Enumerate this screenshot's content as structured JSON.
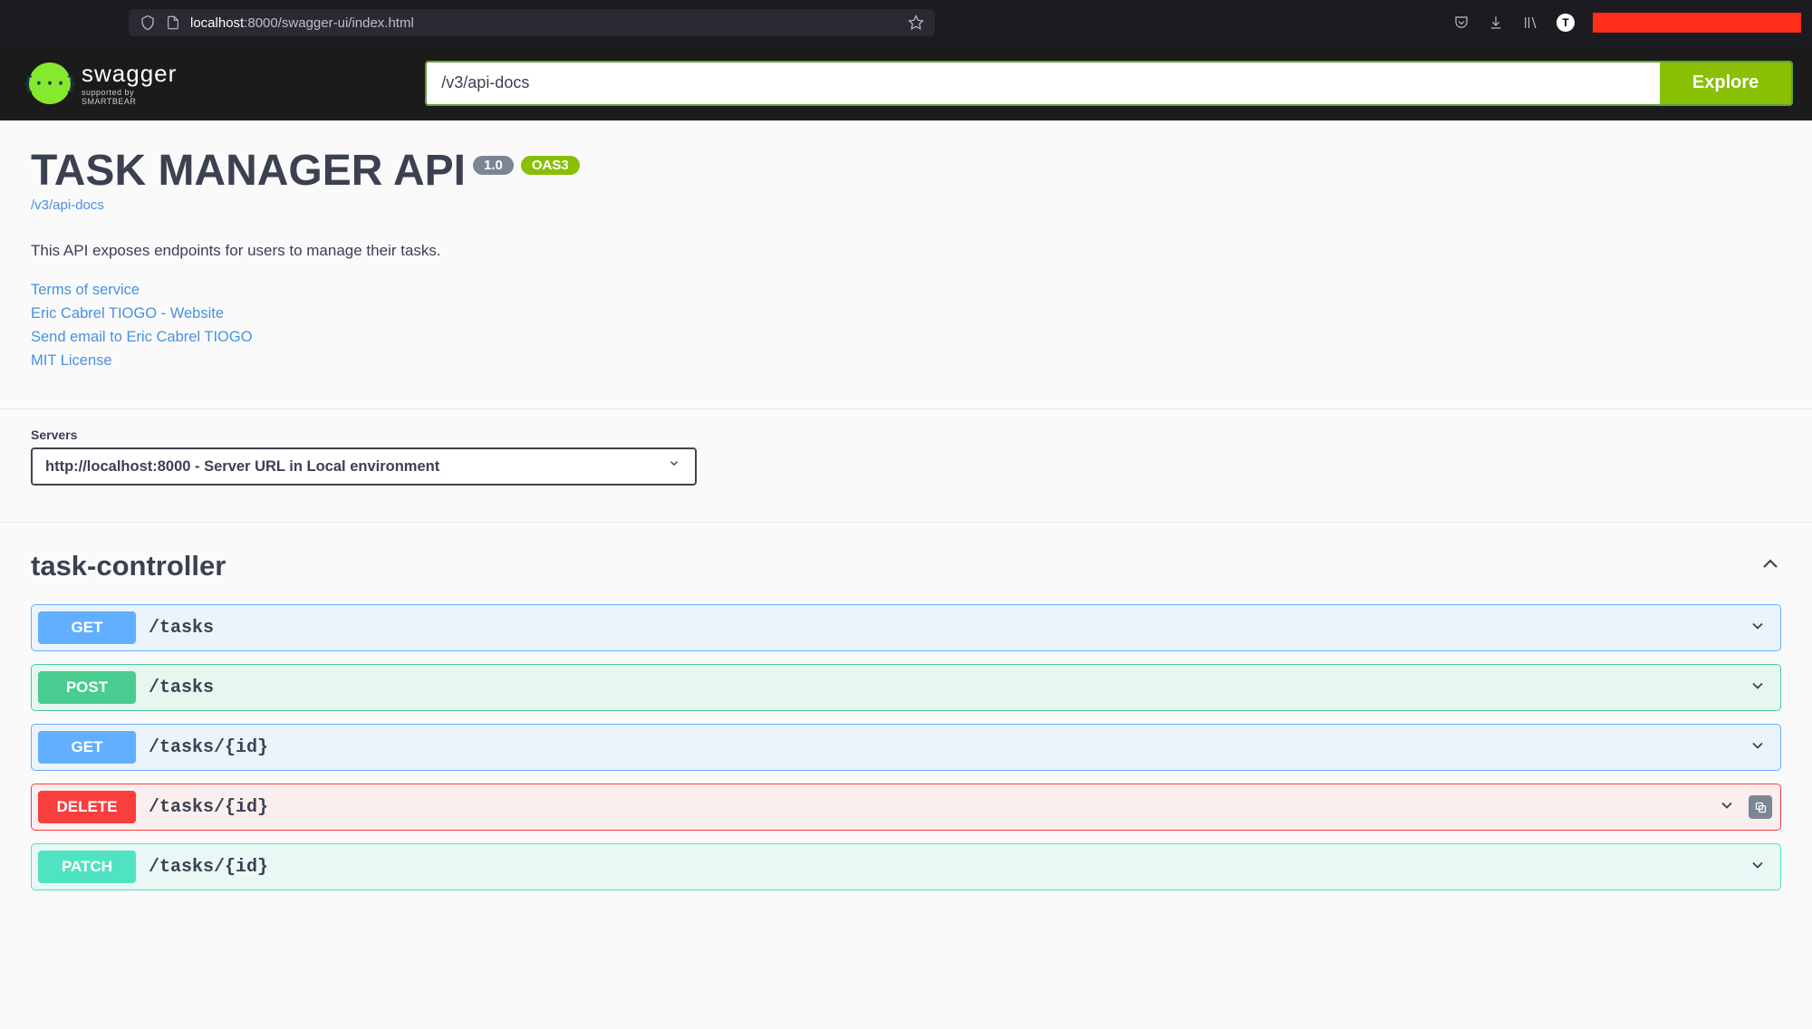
{
  "browser": {
    "url_prefix": "localhost",
    "url_rest": ":8000/swagger-ui/index.html",
    "user_initial": "T"
  },
  "header": {
    "logo_glyph": "{···}",
    "logo_title": "swagger",
    "logo_sub": "supported by SMARTBEAR",
    "explore_input": "/v3/api-docs",
    "explore_btn": "Explore"
  },
  "info": {
    "title": "TASK MANAGER API",
    "version": "1.0",
    "oas": "OAS3",
    "docs_link": "/v3/api-docs",
    "description": "This API exposes endpoints for users to manage their tasks.",
    "links": {
      "terms": "Terms of service",
      "website": "Eric Cabrel TIOGO - Website",
      "email": "Send email to Eric Cabrel TIOGO",
      "license": "MIT License"
    }
  },
  "servers": {
    "label": "Servers",
    "selected": "http://localhost:8000 - Server URL in Local environment"
  },
  "tag": {
    "name": "task-controller"
  },
  "ops": [
    {
      "method": "GET",
      "path": "/tasks",
      "class": "get",
      "copy": false
    },
    {
      "method": "POST",
      "path": "/tasks",
      "class": "post",
      "copy": false
    },
    {
      "method": "GET",
      "path": "/tasks/{id}",
      "class": "get",
      "copy": false
    },
    {
      "method": "DELETE",
      "path": "/tasks/{id}",
      "class": "delete",
      "copy": true
    },
    {
      "method": "PATCH",
      "path": "/tasks/{id}",
      "class": "patch",
      "copy": false
    }
  ]
}
